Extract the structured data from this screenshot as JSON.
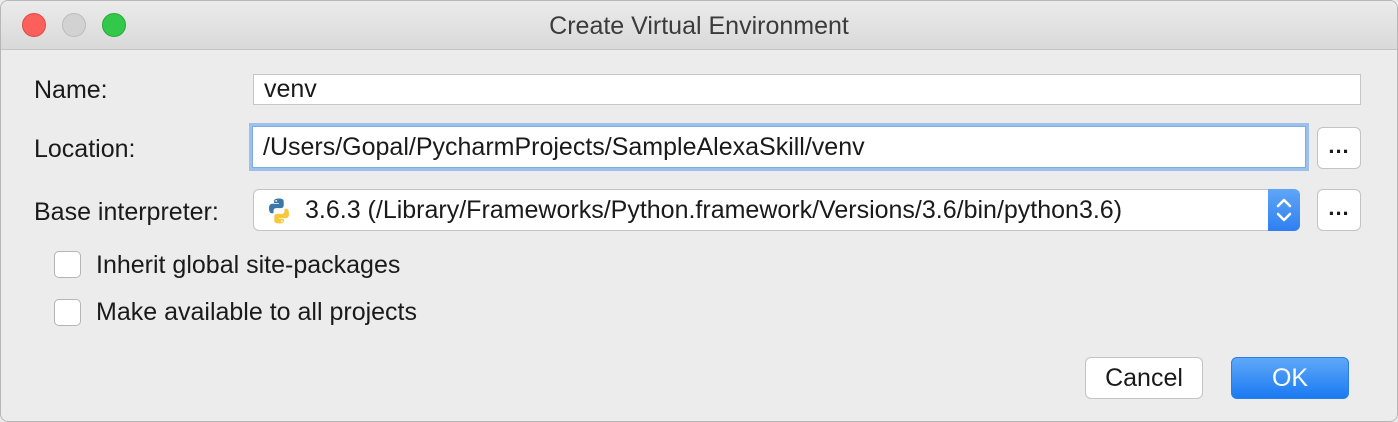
{
  "window": {
    "title": "Create Virtual Environment"
  },
  "form": {
    "name_label": "Name:",
    "name_value": "venv",
    "location_label": "Location:",
    "location_value": "/Users/Gopal/PycharmProjects/SampleAlexaSkill/venv",
    "interpreter_label": "Base interpreter:",
    "interpreter_value": "3.6.3 (/Library/Frameworks/Python.framework/Versions/3.6/bin/python3.6)",
    "browse_label": "...",
    "inherit_label": "Inherit global site-packages",
    "inherit_checked": false,
    "make_available_label": "Make available to all projects",
    "make_available_checked": false
  },
  "buttons": {
    "cancel_label": "Cancel",
    "ok_label": "OK"
  },
  "colors": {
    "accent": "#2f7ff1",
    "focus_ring": "#9cc1ef",
    "close": "#fc605c",
    "zoom": "#34c84a"
  },
  "icons": {
    "interpreter": "python-logo-icon",
    "combo": "chevron-up-down-icon"
  }
}
